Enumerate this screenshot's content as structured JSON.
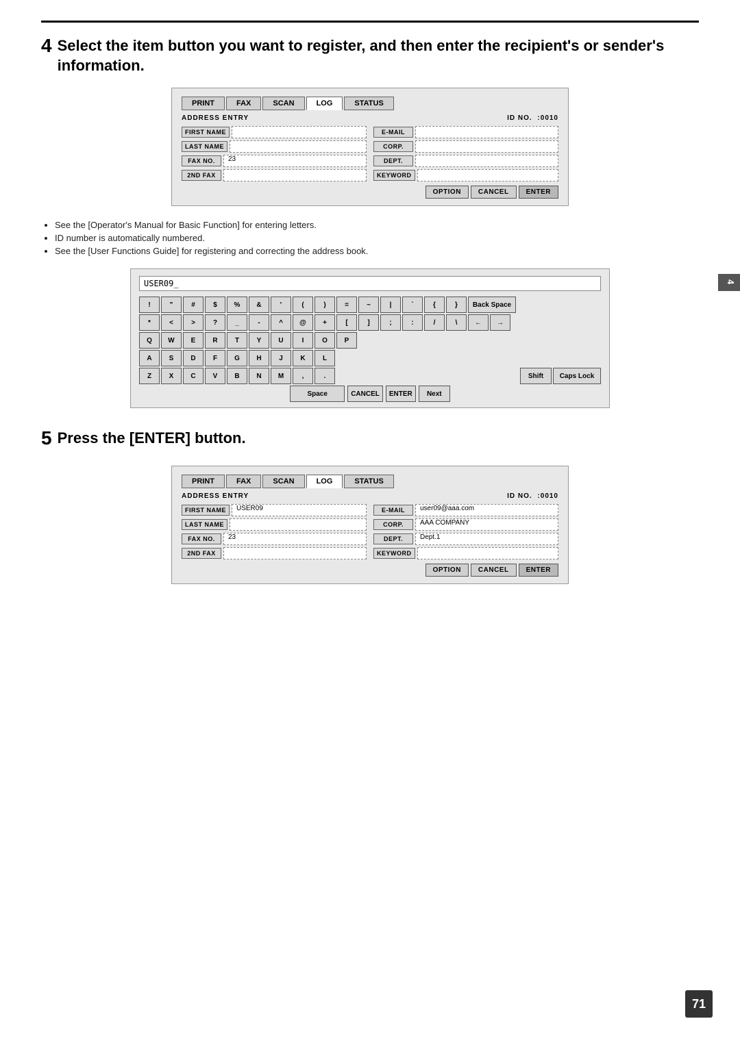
{
  "page": {
    "number": "71",
    "right_tab_label": "4"
  },
  "step4": {
    "number": "4",
    "title": "Select the item button you want to register, and then enter the recipient's or sender's information."
  },
  "step5": {
    "number": "5",
    "title": "Press the [ENTER] button."
  },
  "bullets": [
    "See the [Operator's Manual for Basic Function] for entering letters.",
    "ID number is automatically numbered.",
    "See the [User Functions Guide] for registering and correcting the address book."
  ],
  "panel1": {
    "tabs": [
      "PRINT",
      "FAX",
      "SCAN",
      "LOG",
      "STATUS"
    ],
    "addr_label": "ADDRESS ENTRY",
    "id_label": "ID NO.",
    "id_value": ":0010",
    "fields_left": [
      {
        "label": "FIRST NAME",
        "value": ""
      },
      {
        "label": "LAST NAME",
        "value": ""
      },
      {
        "label": "FAX NO.",
        "value": "23"
      },
      {
        "label": "2ND FAX",
        "value": ""
      }
    ],
    "fields_right": [
      {
        "label": "E-MAIL",
        "value": ""
      },
      {
        "label": "CORP.",
        "value": ""
      },
      {
        "label": "DEPT.",
        "value": ""
      },
      {
        "label": "KEYWORD",
        "value": ""
      }
    ],
    "btn_option": "OPTION",
    "btn_cancel": "CANCEL",
    "btn_enter": "ENTER"
  },
  "keyboard": {
    "display_text": "USER09_",
    "row1": [
      "!",
      "\"",
      "#",
      "$",
      "%",
      "&",
      "'",
      "(",
      ")",
      "=",
      "~",
      "|",
      "`",
      "{",
      "}"
    ],
    "row1_extra": "Back Space",
    "row2": [
      "*",
      "<",
      ">",
      "?",
      "_",
      "-",
      "^",
      "@",
      "+",
      "[",
      "]",
      ";",
      ":",
      "/",
      "\\"
    ],
    "row2_arrows": [
      "←",
      "→"
    ],
    "row3": [
      "Q",
      "W",
      "E",
      "R",
      "T",
      "Y",
      "U",
      "I",
      "O",
      "P"
    ],
    "row4": [
      "A",
      "S",
      "D",
      "F",
      "G",
      "H",
      "J",
      "K",
      "L"
    ],
    "row5": [
      "Z",
      "X",
      "C",
      "V",
      "B",
      "N",
      "M",
      ",",
      "."
    ],
    "row5_extra": [
      "Shift",
      "Caps Lock"
    ],
    "bottom_space": "Space",
    "bottom_cancel": "CANCEL",
    "bottom_enter": "ENTER",
    "bottom_next": "Next"
  },
  "panel2": {
    "tabs": [
      "PRINT",
      "FAX",
      "SCAN",
      "LOG",
      "STATUS"
    ],
    "addr_label": "ADDRESS ENTRY",
    "id_label": "ID NO.",
    "id_value": ":0010",
    "fields_left": [
      {
        "label": "FIRST NAME",
        "value": "USER09"
      },
      {
        "label": "LAST NAME",
        "value": ""
      },
      {
        "label": "FAX NO.",
        "value": "23"
      },
      {
        "label": "2ND FAX",
        "value": ""
      }
    ],
    "fields_right": [
      {
        "label": "E-MAIL",
        "value": "user09@aaa.com"
      },
      {
        "label": "CORP.",
        "value": "AAA COMPANY"
      },
      {
        "label": "DEPT.",
        "value": "Dept.1"
      },
      {
        "label": "KEYWORD",
        "value": ""
      }
    ],
    "btn_option": "OPTION",
    "btn_cancel": "CANCEL",
    "btn_enter": "ENTER"
  }
}
